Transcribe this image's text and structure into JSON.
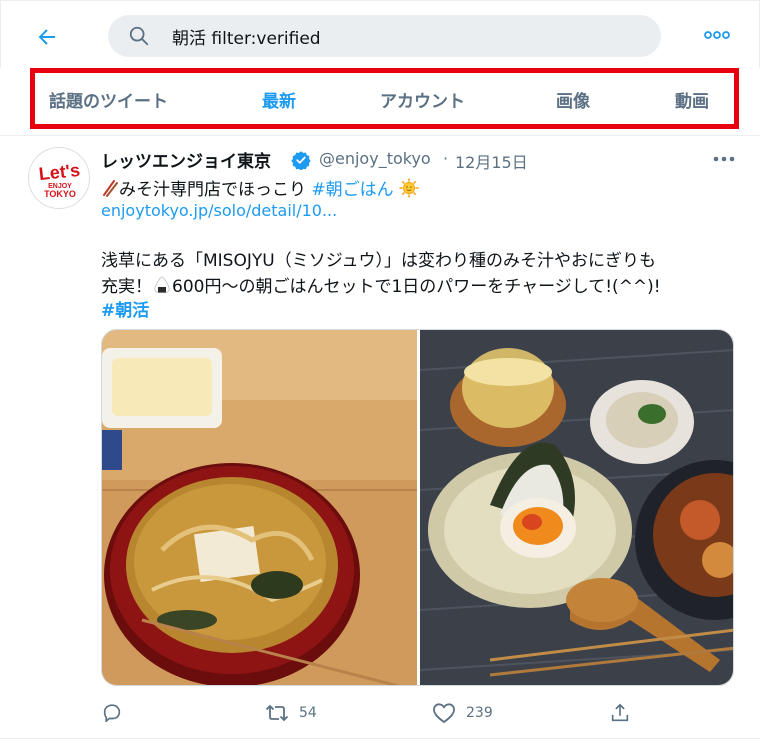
{
  "search": {
    "value": "朝活 filter:verified"
  },
  "tabs": [
    {
      "label": "話題のツイート"
    },
    {
      "label": "最新"
    },
    {
      "label": "アカウント"
    },
    {
      "label": "画像"
    },
    {
      "label": "動画"
    }
  ],
  "tweet": {
    "author_name": "レッツエンジョイ東京",
    "handle": "@enjoy_tokyo",
    "separator": "·",
    "date": "12月15日",
    "line1_prefix": "みそ汁専門店でほっこり ",
    "line1_hashtag": "#朝ごはん",
    "link": "enjoytokyo.jp/solo/detail/10...",
    "body_line1": "浅草にある「MISOJYU（ミソジュウ）」は変わり種のみそ汁やおにぎりも",
    "body_line2_a": "充実！",
    "body_line2_b": "600円～の朝ごはんセットで1日のパワーをチャージして!(^^)!",
    "body_hashtag": "#朝活",
    "avatar_logo": {
      "line1": "Let's",
      "line2": "ENJOY",
      "line3": "TOKYO"
    },
    "retweets": "54",
    "likes": "239"
  },
  "colors": {
    "accent": "#1d9bf0",
    "highlight_border": "#e8000f",
    "muted": "#5b7083"
  },
  "icons": [
    "back-arrow-icon",
    "search-icon",
    "more-icon",
    "verified-icon",
    "chopsticks-icon",
    "sun-emoji-icon",
    "onigiri-emoji-icon",
    "reply-icon",
    "retweet-icon",
    "like-icon",
    "share-icon"
  ]
}
